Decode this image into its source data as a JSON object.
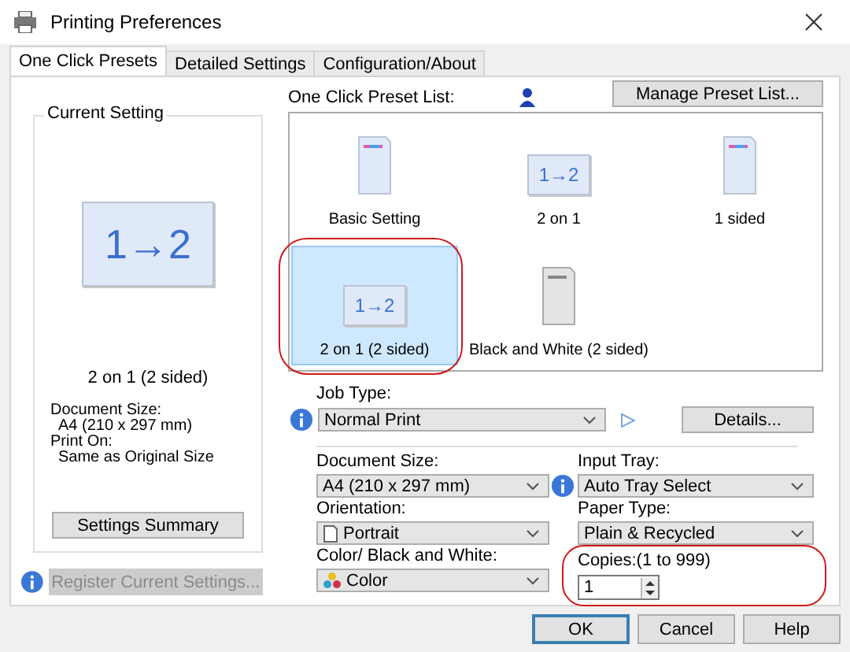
{
  "window": {
    "title": "Printing Preferences"
  },
  "tabs": [
    {
      "label": "One Click Presets",
      "selected": true
    },
    {
      "label": "Detailed Settings",
      "selected": false
    },
    {
      "label": "Configuration/About",
      "selected": false
    }
  ],
  "current_setting": {
    "title": "Current Setting",
    "icon_text": "1→2",
    "preset_name": "2 on 1 (2 sided)",
    "details": [
      {
        "label": "Document Size:",
        "value": "A4 (210 x 297 mm)"
      },
      {
        "label": "Print On:",
        "value": "Same as Original Size"
      }
    ],
    "summary_button": "Settings Summary"
  },
  "register_button": {
    "label": "Register Current Settings...",
    "disabled": true
  },
  "preset_list": {
    "label": "One Click Preset List:",
    "manage_button": "Manage Preset List...",
    "presets": [
      {
        "name": "Basic Setting",
        "kind": "color-page",
        "selected": false
      },
      {
        "name": "2 on 1",
        "kind": "two-on-one",
        "icon_text": "1→2",
        "selected": false
      },
      {
        "name": "1 sided",
        "kind": "color-page",
        "selected": false
      },
      {
        "name": "2 on 1 (2 sided)",
        "kind": "two-on-one",
        "icon_text": "1→2",
        "selected": true
      },
      {
        "name": "Black and White (2 sided)",
        "kind": "mono-page",
        "selected": false
      }
    ]
  },
  "job_type": {
    "label": "Job Type:",
    "value": "Normal Print",
    "details_button": "Details..."
  },
  "document_size": {
    "label": "Document Size:",
    "value": "A4 (210 x 297 mm)"
  },
  "input_tray": {
    "label": "Input Tray:",
    "value": "Auto Tray Select"
  },
  "orientation": {
    "label": "Orientation:",
    "value": "Portrait"
  },
  "paper_type": {
    "label": "Paper Type:",
    "value": "Plain & Recycled"
  },
  "color_mode": {
    "label": "Color/ Black and White:",
    "value": "Color"
  },
  "copies": {
    "label": "Copies:(1 to 999)",
    "value": "1"
  },
  "buttons": [
    {
      "label": "OK",
      "default": true
    },
    {
      "label": "Cancel",
      "default": false
    },
    {
      "label": "Help",
      "default": false
    }
  ]
}
